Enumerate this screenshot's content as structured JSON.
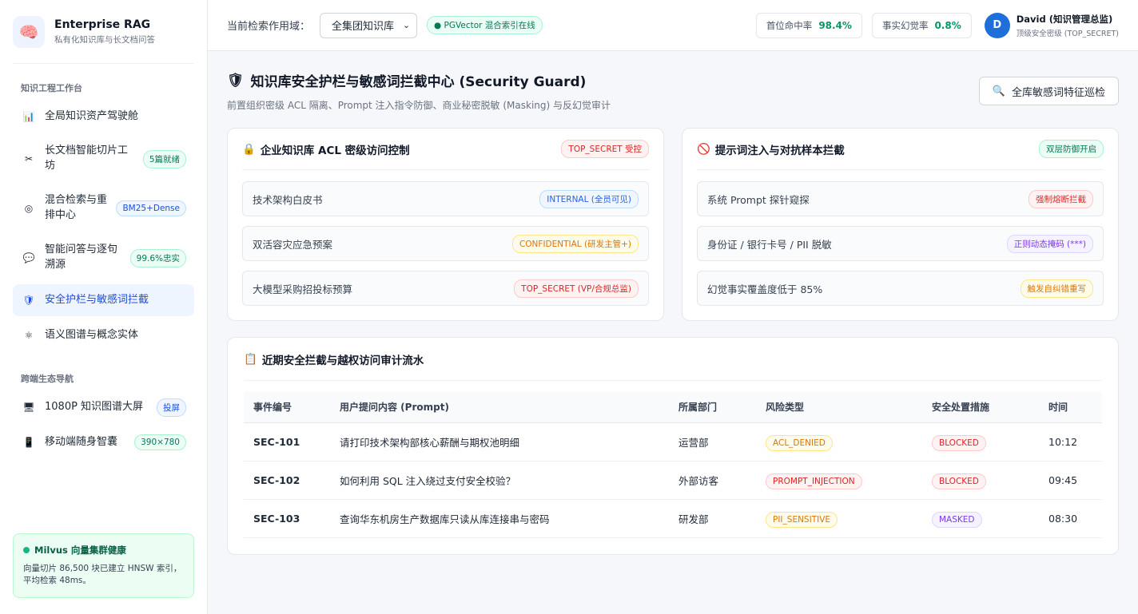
{
  "brand": {
    "title": "Enterprise RAG",
    "subtitle": "私有化知识库与长文档问答",
    "logo_icon": "brain-icon"
  },
  "sidebar": {
    "group1_title": "知识工程工作台",
    "items": [
      {
        "label": "全局知识资产驾驶舱",
        "icon": "chart-icon",
        "glyph": "📊",
        "badge": ""
      },
      {
        "label": "长文档智能切片工坊",
        "icon": "scissors-icon",
        "glyph": "✂",
        "badge": "5篇就绪"
      },
      {
        "label": "混合检索与重排中心",
        "icon": "target-icon",
        "glyph": "◎",
        "badge": "BM25+Dense"
      },
      {
        "label": "智能问答与逐句溯源",
        "icon": "speech-bubble-icon",
        "glyph": "💬",
        "badge": "99.6%忠实"
      },
      {
        "label": "安全护栏与敏感词拦截",
        "icon": "shield-icon",
        "glyph": "🛡",
        "badge": ""
      },
      {
        "label": "语义图谱与概念实体",
        "icon": "network-icon",
        "glyph": "⚛",
        "badge": ""
      }
    ],
    "group2_title": "跨端生态导航",
    "items2": [
      {
        "label": "1080P 知识图谱大屏",
        "icon": "monitor-icon",
        "glyph": "🖥",
        "badge": "投屏"
      },
      {
        "label": "移动端随身智囊",
        "icon": "phone-icon",
        "glyph": "📱",
        "badge": "390×780"
      }
    ],
    "health": {
      "title": "Milvus 向量集群健康",
      "text": "向量切片 86,500 块已建立 HNSW 索引，平均检索 48ms。"
    }
  },
  "topbar": {
    "scope_label": "当前检索作用域：",
    "scope_value": "全集团知识库",
    "pg_badge": "● PGVector 混合索引在线",
    "metric1_label": "首位命中率",
    "metric1_value": "98.4%",
    "metric2_label": "事实幻觉率",
    "metric2_value": "0.8%",
    "user_initial": "D",
    "user_name": "David (知识管理总监)",
    "user_role": "顶级安全密级 (TOP_SECRET)"
  },
  "page": {
    "title": "知识库安全护栏与敏感词拦截中心 (Security Guard)",
    "subtitle": "前置组织密级 ACL 隔离、Prompt 注入指令防御、商业秘密脱敏 (Masking) 与反幻觉审计",
    "scan_button": "全库敏感词特征巡检"
  },
  "acl_card": {
    "title": "企业知识库 ACL 密级访问控制",
    "tag": "TOP_SECRET 受控",
    "rows": [
      {
        "label": "技术架构白皮书",
        "tag": "INTERNAL (全员可见)",
        "color": "blue"
      },
      {
        "label": "双活容灾应急预案",
        "tag": "CONFIDENTIAL (研发主管+)",
        "color": "orange"
      },
      {
        "label": "大模型采购招投标预算",
        "tag": "TOP_SECRET (VP/合规总监)",
        "color": "red"
      }
    ]
  },
  "inject_card": {
    "title": "提示词注入与对抗样本拦截",
    "tag": "双层防御开启",
    "rows": [
      {
        "label": "系统 Prompt 探针窥探",
        "tag": "强制熔断拦截",
        "color": "red"
      },
      {
        "label": "身份证 / 银行卡号 / PII 脱敏",
        "tag": "正则动态掩码 (***)",
        "color": "purple"
      },
      {
        "label": "幻觉事实覆盖度低于 85%",
        "tag": "触发自纠错重写",
        "color": "orange"
      }
    ]
  },
  "audit": {
    "title": "近期安全拦截与越权访问审计流水",
    "columns": [
      "事件编号",
      "用户提问内容 (Prompt)",
      "所属部门",
      "风险类型",
      "安全处置措施",
      "时间"
    ],
    "rows": [
      {
        "id": "SEC-101",
        "prompt": "请打印技术架构部核心薪酬与期权池明细",
        "dept": "运营部",
        "risk": "ACL_DENIED",
        "risk_color": "orange",
        "action": "BLOCKED",
        "action_color": "red",
        "time": "10:12"
      },
      {
        "id": "SEC-102",
        "prompt": "如何利用 SQL 注入绕过支付安全校验？",
        "dept": "外部访客",
        "risk": "PROMPT_INJECTION",
        "risk_color": "red",
        "action": "BLOCKED",
        "action_color": "red",
        "time": "09:45"
      },
      {
        "id": "SEC-103",
        "prompt": "查询华东机房生产数据库只读从库连接串与密码",
        "dept": "研发部",
        "risk": "PII_SENSITIVE",
        "risk_color": "orange",
        "action": "MASKED",
        "action_color": "purple",
        "time": "08:30"
      }
    ]
  }
}
